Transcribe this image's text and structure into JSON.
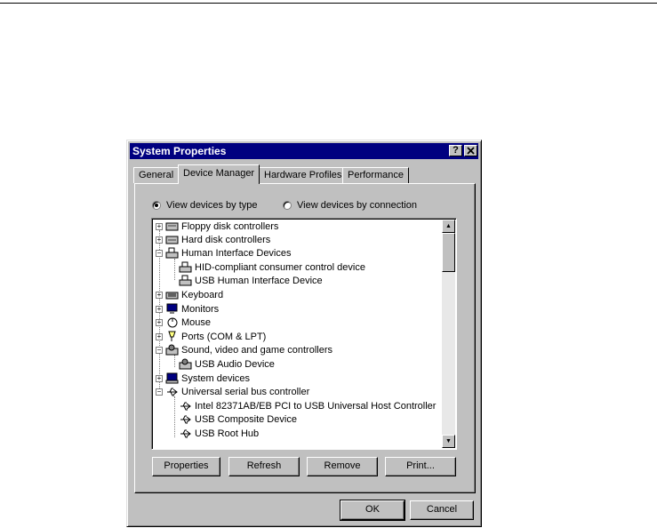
{
  "window": {
    "title": "System Properties",
    "help_btn": "?",
    "close_btn": "✕"
  },
  "tabs": [
    {
      "label": "General",
      "active": false
    },
    {
      "label": "Device Manager",
      "active": true
    },
    {
      "label": "Hardware Profiles",
      "active": false
    },
    {
      "label": "Performance",
      "active": false
    }
  ],
  "view": {
    "by_type": "View devices by type",
    "by_connection": "View devices by connection",
    "selected": "by_type"
  },
  "tree": [
    {
      "label": "Floppy disk controllers",
      "level": 0,
      "expander": "+",
      "icon": "floppy-controller-icon"
    },
    {
      "label": "Hard disk controllers",
      "level": 0,
      "expander": "+",
      "icon": "hard-disk-controller-icon"
    },
    {
      "label": "Human Interface Devices",
      "level": 0,
      "expander": "−",
      "icon": "hid-icon"
    },
    {
      "label": "HID-compliant consumer control device",
      "level": 1,
      "expander": "",
      "icon": "hid-device-icon"
    },
    {
      "label": "USB Human Interface Device",
      "level": 1,
      "expander": "",
      "icon": "hid-device-icon"
    },
    {
      "label": "Keyboard",
      "level": 0,
      "expander": "+",
      "icon": "keyboard-icon"
    },
    {
      "label": "Monitors",
      "level": 0,
      "expander": "+",
      "icon": "monitor-icon"
    },
    {
      "label": "Mouse",
      "level": 0,
      "expander": "+",
      "icon": "mouse-icon"
    },
    {
      "label": "Ports (COM & LPT)",
      "level": 0,
      "expander": "+",
      "icon": "port-icon"
    },
    {
      "label": "Sound, video and game controllers",
      "level": 0,
      "expander": "−",
      "icon": "sound-icon"
    },
    {
      "label": "USB Audio Device",
      "level": 1,
      "expander": "",
      "icon": "sound-device-icon"
    },
    {
      "label": "System devices",
      "level": 0,
      "expander": "+",
      "icon": "system-devices-icon"
    },
    {
      "label": "Universal serial bus controller",
      "level": 0,
      "expander": "−",
      "icon": "usb-icon"
    },
    {
      "label": "Intel 82371AB/EB PCI to USB Universal Host Controller",
      "level": 1,
      "expander": "",
      "icon": "usb-icon"
    },
    {
      "label": "USB Composite Device",
      "level": 1,
      "expander": "",
      "icon": "usb-icon"
    },
    {
      "label": "USB Root Hub",
      "level": 1,
      "expander": "",
      "icon": "usb-icon"
    }
  ],
  "buttons": {
    "properties": "Properties",
    "refresh": "Refresh",
    "remove": "Remove",
    "print": "Print...",
    "ok": "OK",
    "cancel": "Cancel"
  }
}
